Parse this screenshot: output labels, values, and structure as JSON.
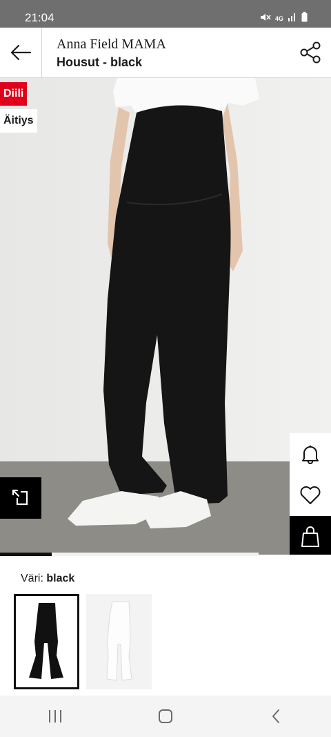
{
  "status_bar": {
    "time": "21:04",
    "network": "4G"
  },
  "header": {
    "brand": "Anna Field MAMA",
    "product_name": "Housut - black",
    "back_icon": "arrow-left-icon",
    "share_icon": "share-icon"
  },
  "badges": {
    "deal": "Diili",
    "maternity": "Äitiys"
  },
  "colors": {
    "deal_red": "#e0001b",
    "ink": "#111111"
  },
  "gallery": {
    "active_index": 1,
    "total_images": 5
  },
  "product": {
    "color_label": "Väri:",
    "color_value": "black"
  },
  "swatches": [
    {
      "name": "black",
      "selected": true
    },
    {
      "name": "white",
      "selected": false
    }
  ],
  "actions": {
    "notify_icon": "bell-icon",
    "wishlist_icon": "heart-icon",
    "cart_icon": "shopping-bag-icon",
    "compare_icon": "compare-icon"
  },
  "nav": {
    "recent_icon": "recent-apps-icon",
    "home_icon": "home-icon",
    "back_icon": "system-back-icon"
  }
}
